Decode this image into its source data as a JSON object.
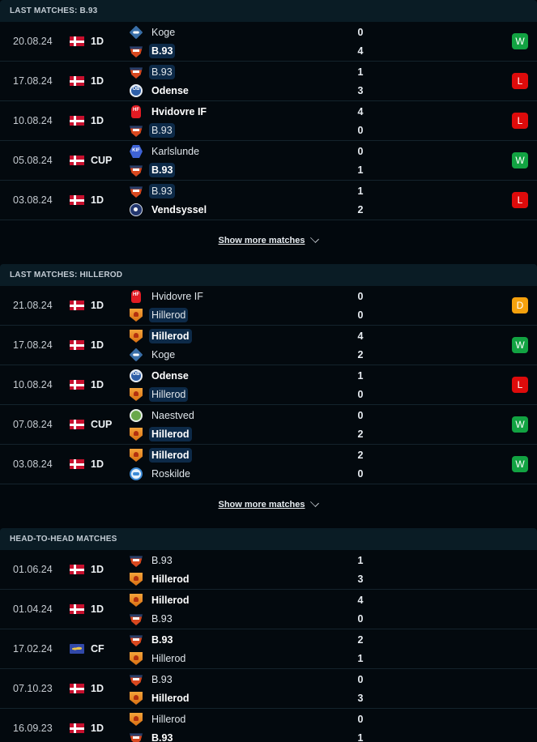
{
  "sections": [
    {
      "title": "LAST MATCHES: B.93",
      "show_more": "Show more matches",
      "matches": [
        {
          "date": "20.08.24",
          "flag": "denmark",
          "comp": "1D",
          "home": {
            "name": "Koge",
            "logo": "koge",
            "bold": false,
            "highlight": false
          },
          "home_score": "0",
          "away": {
            "name": "B.93",
            "logo": "b93",
            "bold": true,
            "highlight": true
          },
          "away_score": "4",
          "result": "W"
        },
        {
          "date": "17.08.24",
          "flag": "denmark",
          "comp": "1D",
          "home": {
            "name": "B.93",
            "logo": "b93",
            "bold": false,
            "highlight": true
          },
          "home_score": "1",
          "away": {
            "name": "Odense",
            "logo": "odense",
            "bold": true,
            "highlight": false
          },
          "away_score": "3",
          "result": "L"
        },
        {
          "date": "10.08.24",
          "flag": "denmark",
          "comp": "1D",
          "home": {
            "name": "Hvidovre IF",
            "logo": "hvidovre",
            "bold": true,
            "highlight": false
          },
          "home_score": "4",
          "away": {
            "name": "B.93",
            "logo": "b93",
            "bold": false,
            "highlight": true
          },
          "away_score": "0",
          "result": "L"
        },
        {
          "date": "05.08.24",
          "flag": "denmark",
          "comp": "CUP",
          "home": {
            "name": "Karlslunde",
            "logo": "karlslunde",
            "bold": false,
            "highlight": false
          },
          "home_score": "0",
          "away": {
            "name": "B.93",
            "logo": "b93",
            "bold": true,
            "highlight": true
          },
          "away_score": "1",
          "result": "W"
        },
        {
          "date": "03.08.24",
          "flag": "denmark",
          "comp": "1D",
          "home": {
            "name": "B.93",
            "logo": "b93",
            "bold": false,
            "highlight": true
          },
          "home_score": "1",
          "away": {
            "name": "Vendsyssel",
            "logo": "vendsyssel",
            "bold": true,
            "highlight": false
          },
          "away_score": "2",
          "result": "L"
        }
      ]
    },
    {
      "title": "LAST MATCHES: HILLEROD",
      "show_more": "Show more matches",
      "matches": [
        {
          "date": "21.08.24",
          "flag": "denmark",
          "comp": "1D",
          "home": {
            "name": "Hvidovre IF",
            "logo": "hvidovre",
            "bold": false,
            "highlight": false
          },
          "home_score": "0",
          "away": {
            "name": "Hillerod",
            "logo": "hillerod",
            "bold": false,
            "highlight": true
          },
          "away_score": "0",
          "result": "D"
        },
        {
          "date": "17.08.24",
          "flag": "denmark",
          "comp": "1D",
          "home": {
            "name": "Hillerod",
            "logo": "hillerod",
            "bold": true,
            "highlight": true
          },
          "home_score": "4",
          "away": {
            "name": "Koge",
            "logo": "koge",
            "bold": false,
            "highlight": false
          },
          "away_score": "2",
          "result": "W"
        },
        {
          "date": "10.08.24",
          "flag": "denmark",
          "comp": "1D",
          "home": {
            "name": "Odense",
            "logo": "odense",
            "bold": true,
            "highlight": false
          },
          "home_score": "1",
          "away": {
            "name": "Hillerod",
            "logo": "hillerod",
            "bold": false,
            "highlight": true
          },
          "away_score": "0",
          "result": "L"
        },
        {
          "date": "07.08.24",
          "flag": "denmark",
          "comp": "CUP",
          "home": {
            "name": "Naestved",
            "logo": "naestved",
            "bold": false,
            "highlight": false
          },
          "home_score": "0",
          "away": {
            "name": "Hillerod",
            "logo": "hillerod",
            "bold": true,
            "highlight": true
          },
          "away_score": "2",
          "result": "W"
        },
        {
          "date": "03.08.24",
          "flag": "denmark",
          "comp": "1D",
          "home": {
            "name": "Hillerod",
            "logo": "hillerod",
            "bold": true,
            "highlight": true
          },
          "home_score": "2",
          "away": {
            "name": "Roskilde",
            "logo": "roskilde",
            "bold": false,
            "highlight": false
          },
          "away_score": "0",
          "result": "W"
        }
      ]
    },
    {
      "title": "HEAD-TO-HEAD MATCHES",
      "show_more": null,
      "matches": [
        {
          "date": "01.06.24",
          "flag": "denmark",
          "comp": "1D",
          "home": {
            "name": "B.93",
            "logo": "b93",
            "bold": false,
            "highlight": false
          },
          "home_score": "1",
          "away": {
            "name": "Hillerod",
            "logo": "hillerod",
            "bold": true,
            "highlight": false
          },
          "away_score": "3",
          "result": null
        },
        {
          "date": "01.04.24",
          "flag": "denmark",
          "comp": "1D",
          "home": {
            "name": "Hillerod",
            "logo": "hillerod",
            "bold": true,
            "highlight": false
          },
          "home_score": "4",
          "away": {
            "name": "B.93",
            "logo": "b93",
            "bold": false,
            "highlight": false
          },
          "away_score": "0",
          "result": null
        },
        {
          "date": "17.02.24",
          "flag": "world",
          "comp": "CF",
          "home": {
            "name": "B.93",
            "logo": "b93",
            "bold": true,
            "highlight": false
          },
          "home_score": "2",
          "away": {
            "name": "Hillerod",
            "logo": "hillerod",
            "bold": false,
            "highlight": false
          },
          "away_score": "1",
          "result": null
        },
        {
          "date": "07.10.23",
          "flag": "denmark",
          "comp": "1D",
          "home": {
            "name": "B.93",
            "logo": "b93",
            "bold": false,
            "highlight": false
          },
          "home_score": "0",
          "away": {
            "name": "Hillerod",
            "logo": "hillerod",
            "bold": true,
            "highlight": false
          },
          "away_score": "3",
          "result": null
        },
        {
          "date": "16.09.23",
          "flag": "denmark",
          "comp": "1D",
          "home": {
            "name": "Hillerod",
            "logo": "hillerod",
            "bold": false,
            "highlight": false
          },
          "home_score": "0",
          "away": {
            "name": "B.93",
            "logo": "b93",
            "bold": true,
            "highlight": false
          },
          "away_score": "1",
          "result": null
        }
      ]
    }
  ],
  "colors": {
    "win": "#12a342",
    "loss": "#de0b0b",
    "draw": "#f5a10d",
    "highlight": "#0d2a48",
    "header_bg": "#0a1c25",
    "page_bg": "#02080d"
  }
}
